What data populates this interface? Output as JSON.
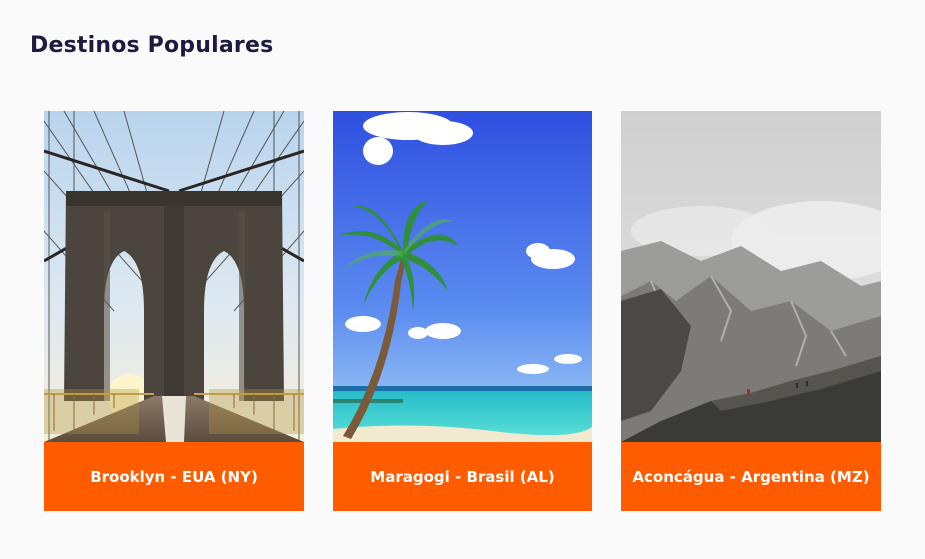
{
  "section": {
    "title": "Destinos Populares"
  },
  "destinations": [
    {
      "label": "Brooklyn - EUA (NY)",
      "image": "brooklyn-bridge-photo"
    },
    {
      "label": "Maragogi - Brasil (AL)",
      "image": "tropical-beach-palm-photo"
    },
    {
      "label": "Aconcágua - Argentina (MZ)",
      "image": "mountain-range-photo"
    }
  ],
  "colors": {
    "accent": "#ff5c00",
    "title": "#1d1b3f",
    "background": "#fafafa",
    "caption_text": "#ffffff"
  }
}
